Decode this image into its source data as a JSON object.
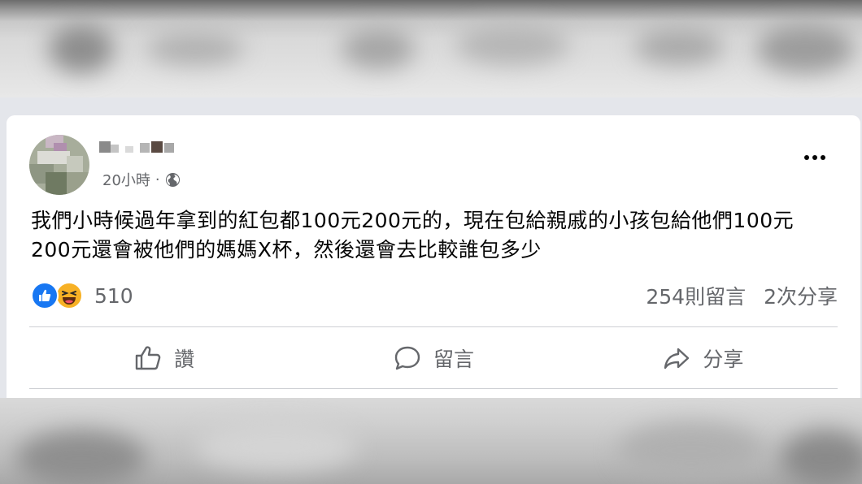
{
  "post": {
    "timestamp": "20小時",
    "separator": "·",
    "text_lines": [
      "我們小時候過年拿到的紅包都100元200元的，現在包給親戚的小孩包給他們100元",
      "200元還會被他們的媽媽X杯，然後還會去比較誰包多少"
    ]
  },
  "engagement": {
    "reaction_count": "510",
    "comments": "254則留言",
    "shares": "2次分享"
  },
  "actions": {
    "like": "讚",
    "comment": "留言",
    "share": "分享"
  },
  "colors": {
    "like_blue": "#1877f2",
    "haha_yellow": "#f7b125",
    "secondary_text": "#65676b",
    "divider": "#ced0d4"
  },
  "icons": [
    "globe-icon",
    "more-options-icon",
    "like-reaction-icon",
    "haha-reaction-icon",
    "thumbs-up-icon",
    "comment-icon",
    "share-arrow-icon"
  ]
}
